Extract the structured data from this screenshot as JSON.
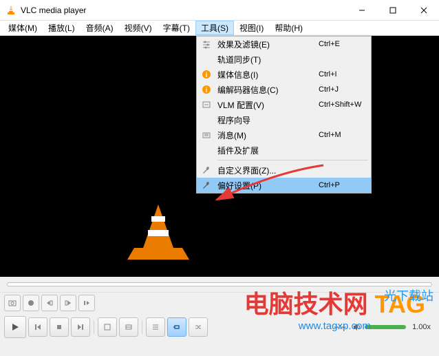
{
  "titlebar": {
    "title": "VLC media player"
  },
  "menubar": {
    "items": [
      "媒体(M)",
      "播放(L)",
      "音频(A)",
      "视频(V)",
      "字幕(T)",
      "工具(S)",
      "视图(I)",
      "帮助(H)"
    ],
    "active_index": 5
  },
  "dropdown": {
    "items": [
      {
        "icon": "sliders",
        "label": "效果及滤镜(E)",
        "shortcut": "Ctrl+E"
      },
      {
        "icon": "",
        "label": "轨道同步(T)",
        "shortcut": ""
      },
      {
        "icon": "info-orange",
        "label": "媒体信息(I)",
        "shortcut": "Ctrl+I"
      },
      {
        "icon": "info-orange",
        "label": "编解码器信息(C)",
        "shortcut": "Ctrl+J"
      },
      {
        "icon": "vlm",
        "label": "VLM 配置(V)",
        "shortcut": "Ctrl+Shift+W"
      },
      {
        "icon": "",
        "label": "程序向导",
        "shortcut": ""
      },
      {
        "icon": "message",
        "label": "消息(M)",
        "shortcut": "Ctrl+M"
      },
      {
        "icon": "",
        "label": "插件及扩展",
        "shortcut": ""
      },
      {
        "sep": true
      },
      {
        "icon": "wrench",
        "label": "自定义界面(Z)...",
        "shortcut": ""
      },
      {
        "icon": "wrench",
        "label": "偏好设置(P)",
        "shortcut": "Ctrl+P",
        "highlighted": true
      }
    ]
  },
  "controls": {
    "time": "--:--",
    "speed": "1.00x",
    "time_end": "--:--"
  },
  "watermark": {
    "line1a": "电脑技术网",
    "line1b": "TAG",
    "url": "www.tagxp.com",
    "side": "光下载站"
  }
}
